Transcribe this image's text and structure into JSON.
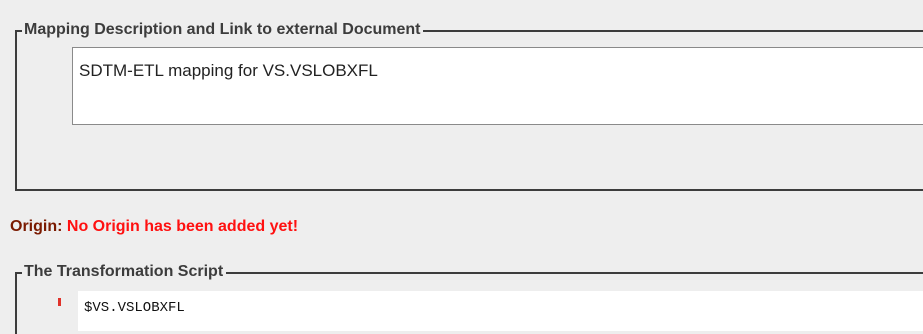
{
  "mapping_group": {
    "title": "Mapping Description and Link to external Document",
    "description_value": "SDTM-ETL mapping for VS.VSLOBXFL"
  },
  "origin": {
    "label": "Origin:",
    "value": "No Origin has been added yet!"
  },
  "script_group": {
    "title": "The Transformation Script",
    "first_line": "$VS.VSLOBXFL"
  },
  "colors": {
    "origin_label": "#7a1a00",
    "origin_value": "#ff1010",
    "border": "#3c3c3c"
  }
}
